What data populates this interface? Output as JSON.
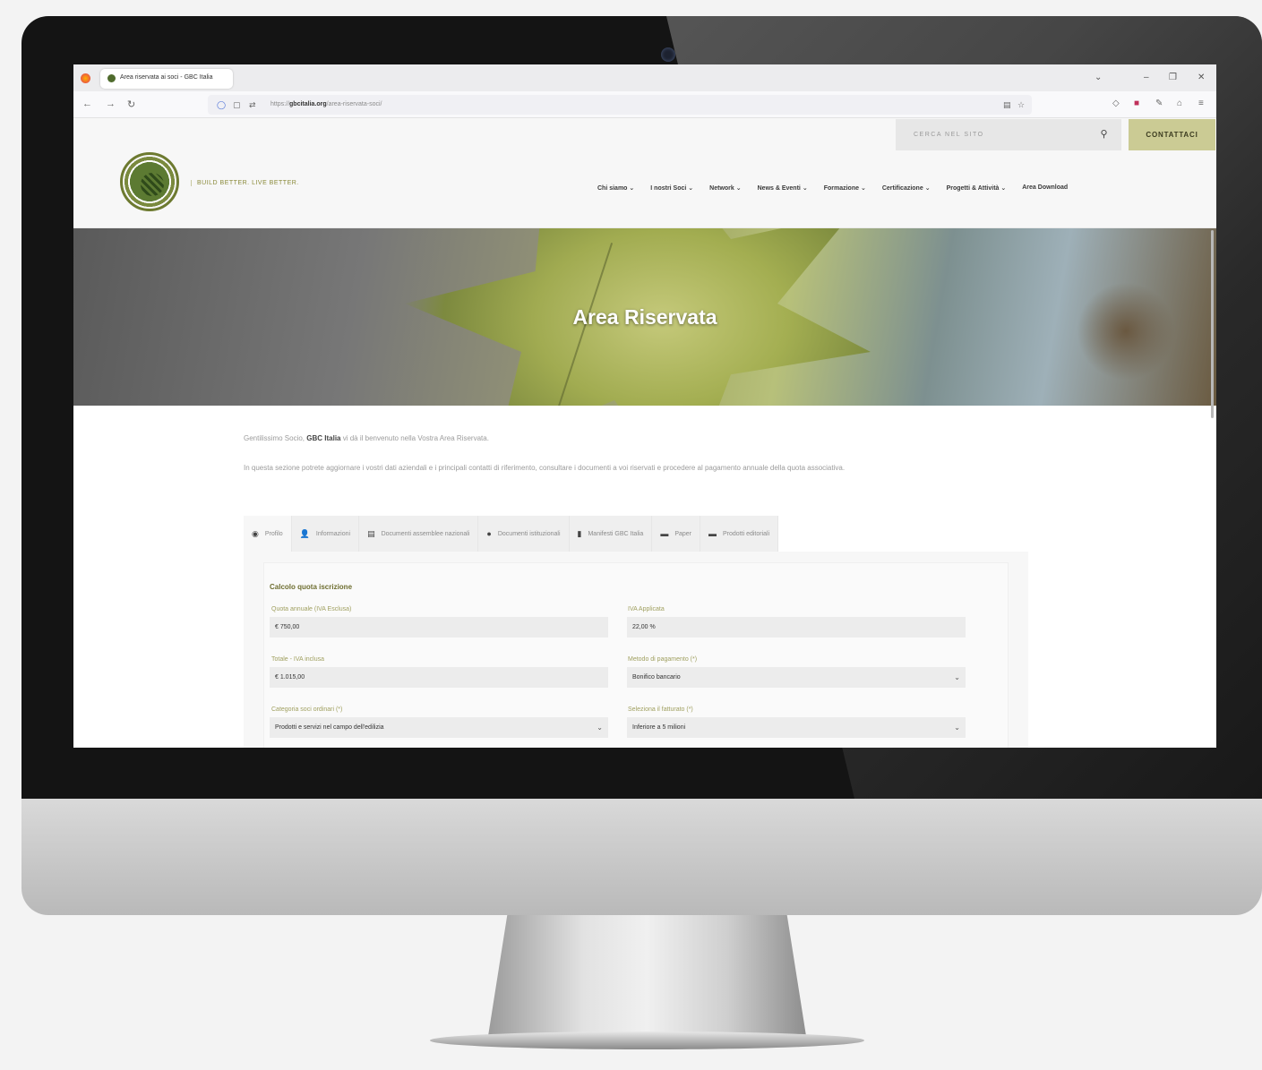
{
  "browser": {
    "tab_title": "Area riservata ai soci - GBC Italia",
    "url_prefix": "https://",
    "url_domain": "gbcitalia.org",
    "url_path": "/area-riservata-soci/",
    "nav_back": "←",
    "nav_forward": "→",
    "nav_reload": "↻",
    "win_controls": [
      "⌄",
      "–",
      "❐",
      "✕"
    ]
  },
  "header": {
    "search_placeholder": "CERCA NEL SITO",
    "contact_label": "CONTATTACI",
    "tagline": "BUILD BETTER. LIVE BETTER.",
    "menu": [
      {
        "label": "Chi siamo",
        "caret": "⌄"
      },
      {
        "label": "I nostri Soci",
        "caret": "⌄"
      },
      {
        "label": "Network",
        "caret": "⌄"
      },
      {
        "label": "News & Eventi",
        "caret": "⌄"
      },
      {
        "label": "Formazione",
        "caret": "⌄"
      },
      {
        "label": "Certificazione",
        "caret": "⌄"
      },
      {
        "label": "Progetti & Attività",
        "caret": "⌄"
      },
      {
        "label": "Area Download",
        "caret": ""
      }
    ]
  },
  "hero": {
    "title": "Area Riservata"
  },
  "content": {
    "intro_prefix": "Gentilissimo Socio,",
    "intro_brand": "GBC Italia",
    "intro_suffix": "vi dà il benvenuto nella Vostra Area Riservata.",
    "intro_2": "In questa sezione potrete aggiornare i vostri dati aziendali e i principali contatti di riferimento, consultare i documenti a voi riservati e procedere al pagamento annuale della quota associativa.",
    "tabs": [
      {
        "label": "Profilo",
        "icon": "◉"
      },
      {
        "label": "Informazioni",
        "icon": "👤"
      },
      {
        "label": "Documenti assemblee nazionali",
        "icon": "▤"
      },
      {
        "label": "Documenti istituzionali",
        "icon": "●"
      },
      {
        "label": "Manifesti GBC Italia",
        "icon": "▮"
      },
      {
        "label": "Paper",
        "icon": "▬"
      },
      {
        "label": "Prodotti editoriali",
        "icon": "▬"
      }
    ],
    "form_title": "Calcolo quota iscrizione",
    "fields": {
      "quota_label": "Quota annuale (IVA Esclusa)",
      "quota_value": "€ 750,00",
      "iva_label": "IVA Applicata",
      "iva_value": "22,00 %",
      "totale_label": "Totale - IVA inclusa",
      "totale_value": "€ 1.015,00",
      "metodo_label": "Metodo di pagamento (*)",
      "metodo_value": "Bonifico bancario",
      "categoria_label": "Categoria soci ordinari (*)",
      "categoria_value": "Prodotti e servizi nel campo dell'edilizia",
      "fatturato_label": "Seleziona il fatturato (*)",
      "fatturato_value": "Inferiore a 5 milioni",
      "select_caret": "⌄"
    }
  }
}
